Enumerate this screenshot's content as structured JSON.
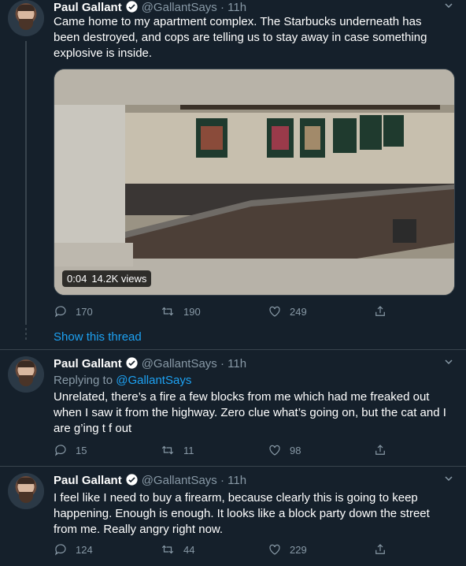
{
  "tweets": [
    {
      "name": "Paul Gallant",
      "handle_time": "@GallantSays · 11h",
      "text": "Came home to my apartment complex. The Starbucks underneath has been destroyed, and cops are telling us to stay away in case something explosive is inside.",
      "media": {
        "duration": "0:04",
        "views": "14.2K views"
      },
      "replies": "170",
      "retweets": "190",
      "likes": "249"
    },
    {
      "name": "Paul Gallant",
      "handle_time": "@GallantSays · 11h",
      "replying_prefix": "Replying to",
      "replying_handle": "@GallantSays",
      "text": "Unrelated, there’s a fire a few blocks from me which had me freaked out when I saw it from the highway. Zero clue what’s going on, but the cat and I are g’ing t f out",
      "replies": "15",
      "retweets": "11",
      "likes": "98"
    },
    {
      "name": "Paul Gallant",
      "handle_time": "@GallantSays · 11h",
      "text": "I feel like I need to buy a firearm, because clearly this is going to keep happening. Enough is enough. It looks like a block party down the street from me. Really angry right now.",
      "replies": "124",
      "retweets": "44",
      "likes": "229"
    }
  ],
  "show_thread": "Show this thread",
  "colors": {
    "background": "#15202b",
    "accent": "#1da1f2",
    "muted": "#8899a6",
    "border": "#38444d"
  },
  "icons": [
    "verified-icon",
    "chevron-down-icon",
    "reply-icon",
    "retweet-icon",
    "like-icon",
    "share-icon"
  ]
}
